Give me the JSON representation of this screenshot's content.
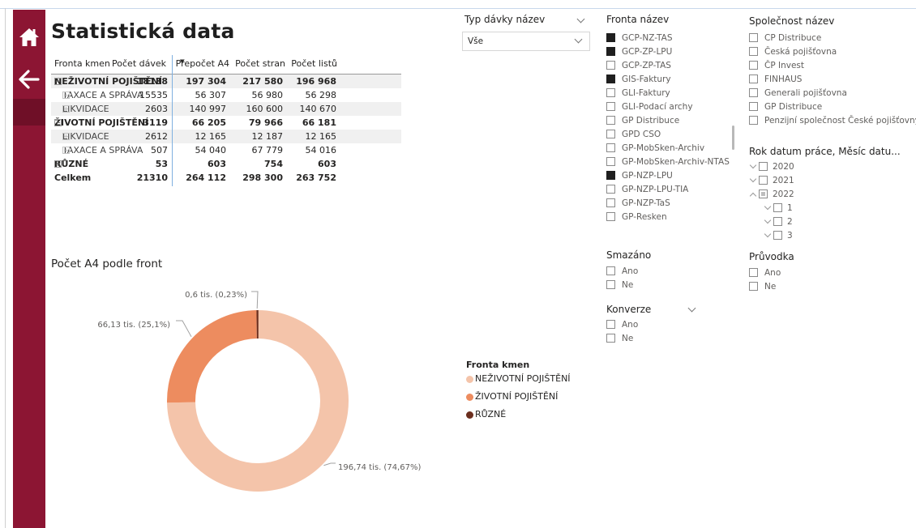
{
  "page": {
    "title": "Statistická data"
  },
  "nav": {
    "home_icon": "home-icon",
    "back_icon": "back-arrow-icon"
  },
  "matrix": {
    "headers": [
      "Fronta kmen",
      "Počet dávek",
      "Přepočet A4",
      "Počet stran",
      "Počet listů"
    ],
    "rows": [
      {
        "label": "NEŽIVOTNÍ POJIŠTĚNÍ",
        "v1": "18138",
        "v2": "197 304",
        "v3": "217 580",
        "v4": "196 968",
        "level": 0,
        "expand": "⊟",
        "bold": true
      },
      {
        "label": "TAXACE A SPRÁVA",
        "v1": "15535",
        "v2": "56 307",
        "v3": "56 980",
        "v4": "56 298",
        "level": 1,
        "expand": "⊞",
        "bold": false
      },
      {
        "label": "LIKVIDACE",
        "v1": "2603",
        "v2": "140 997",
        "v3": "160 600",
        "v4": "140 670",
        "level": 1,
        "expand": "⊞",
        "bold": false
      },
      {
        "label": "ŽIVOTNÍ POJIŠTĚNÍ",
        "v1": "3119",
        "v2": "66 205",
        "v3": "79 966",
        "v4": "66 181",
        "level": 0,
        "expand": "⊟",
        "bold": true
      },
      {
        "label": "LIKVIDACE",
        "v1": "2612",
        "v2": "12 165",
        "v3": "12 187",
        "v4": "12 165",
        "level": 1,
        "expand": "⊞",
        "bold": false
      },
      {
        "label": "TAXACE A SPRÁVA",
        "v1": "507",
        "v2": "54 040",
        "v3": "67 779",
        "v4": "54 016",
        "level": 1,
        "expand": "⊞",
        "bold": false
      },
      {
        "label": "RŮZNÉ",
        "v1": "53",
        "v2": "603",
        "v3": "754",
        "v4": "603",
        "level": 0,
        "expand": "⊞",
        "bold": true
      },
      {
        "label": "Celkem",
        "v1": "21310",
        "v2": "264 112",
        "v3": "298 300",
        "v4": "263 752",
        "level": 0,
        "expand": "",
        "bold": true
      }
    ]
  },
  "chart_data": {
    "type": "pie",
    "title": "Počet A4 podle front",
    "legend_title": "Fronta kmen",
    "legend_placement": "right-bottom",
    "categories": [
      "NEŽIVOTNÍ POJIŠTĚNÍ",
      "ŽIVOTNÍ POJIŠTĚNÍ",
      "RŮZNÉ"
    ],
    "values": [
      196.74,
      66.13,
      0.6
    ],
    "percents": [
      74.67,
      25.1,
      0.23
    ],
    "data_labels": [
      "196,74 tis. (74,67%)",
      "66,13 tis. (25,1%)",
      "0,6 tis. (0,23%)"
    ],
    "colors": [
      "#f4c4aa",
      "#ed8c5f",
      "#6b2e1e"
    ],
    "unit": "tis."
  },
  "slicers": {
    "typ": {
      "title": "Typ dávky název",
      "value": "Vše"
    },
    "fronta": {
      "title": "Fronta název",
      "items": [
        {
          "label": "GCP-NZ-TAS",
          "checked": true
        },
        {
          "label": "GCP-ZP-LPU",
          "checked": true
        },
        {
          "label": "GCP-ZP-TAS",
          "checked": false
        },
        {
          "label": "GIS-Faktury",
          "checked": true
        },
        {
          "label": "GLI-Faktury",
          "checked": false
        },
        {
          "label": "GLI-Podací archy",
          "checked": false
        },
        {
          "label": "GP Distribuce",
          "checked": false
        },
        {
          "label": "GPD CSO",
          "checked": false
        },
        {
          "label": "GP-MobSken-Archiv",
          "checked": false
        },
        {
          "label": "GP-MobSken-Archiv-NTAS",
          "checked": false
        },
        {
          "label": "GP-NZP-LPU",
          "checked": true
        },
        {
          "label": "GP-NZP-LPU-TIA",
          "checked": false
        },
        {
          "label": "GP-NZP-TaS",
          "checked": false
        },
        {
          "label": "GP-Resken",
          "checked": false
        }
      ]
    },
    "spolecnost": {
      "title": "Společnost název",
      "items": [
        "CP Distribuce",
        "Česká pojišťovna",
        "ČP Invest",
        "FINHAUS",
        "Generali pojišťovna",
        "GP Distribuce",
        "Penzijní společnost České pojišťovny"
      ]
    },
    "rok": {
      "title": "Rok datum práce, Měsíc datu...",
      "items": [
        {
          "label": "2020",
          "indent": 0,
          "expanded": false,
          "mixed": false
        },
        {
          "label": "2021",
          "indent": 0,
          "expanded": false,
          "mixed": false
        },
        {
          "label": "2022",
          "indent": 0,
          "expanded": true,
          "mixed": true
        },
        {
          "label": "1",
          "indent": 1,
          "expanded": false,
          "mixed": false
        },
        {
          "label": "2",
          "indent": 1,
          "expanded": false,
          "mixed": false
        },
        {
          "label": "3",
          "indent": 1,
          "expanded": false,
          "mixed": false
        }
      ]
    },
    "smazano": {
      "title": "Smazáno",
      "items": [
        "Ano",
        "Ne"
      ]
    },
    "pruvodka": {
      "title": "Průvodka",
      "items": [
        "Ano",
        "Ne"
      ]
    },
    "konverze": {
      "title": "Konverze",
      "items": [
        "Ano",
        "Ne"
      ]
    }
  }
}
